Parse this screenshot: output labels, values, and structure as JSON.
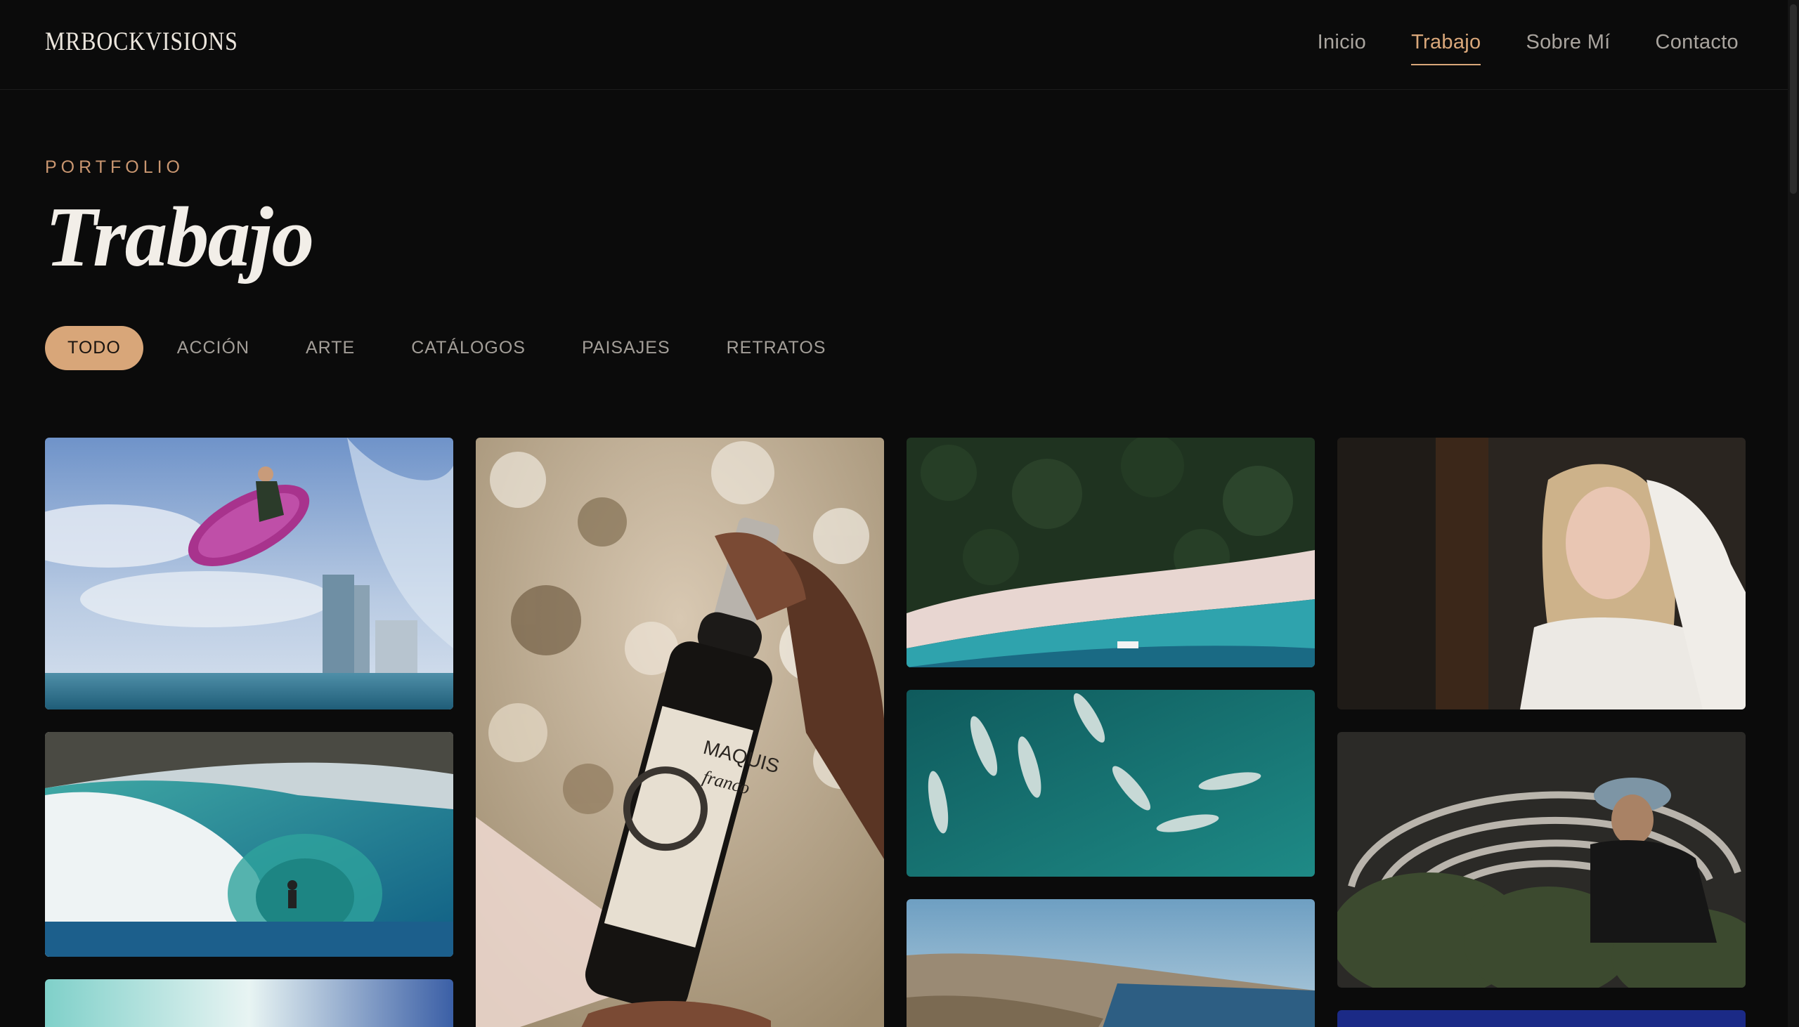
{
  "brand": {
    "logo": "MRBOCKVISIONS"
  },
  "nav": {
    "items": [
      {
        "label": "Inicio"
      },
      {
        "label": "Trabajo",
        "active": true
      },
      {
        "label": "Sobre Mí"
      },
      {
        "label": "Contacto"
      }
    ]
  },
  "hero": {
    "eyebrow": "PORTFOLIO",
    "title": "Trabajo"
  },
  "filters": {
    "items": [
      {
        "label": "TODO",
        "active": true
      },
      {
        "label": "ACCIÓN"
      },
      {
        "label": "ARTE"
      },
      {
        "label": "CATÁLOGOS"
      },
      {
        "label": "PAISAJES"
      },
      {
        "label": "RETRATOS"
      }
    ]
  },
  "gallery": {
    "photos": [
      {
        "subject": "surfer-aerial-jump"
      },
      {
        "subject": "surfer-in-barrel-wave"
      },
      {
        "subject": "ocean-wave"
      },
      {
        "subject": "wine-bottle",
        "label_text": [
          "MAQUIS",
          "franco"
        ]
      },
      {
        "subject": "aerial-beach"
      },
      {
        "subject": "dolphins"
      },
      {
        "subject": "coastal-landscape"
      },
      {
        "subject": "woman-portrait"
      },
      {
        "subject": "man-with-plants"
      },
      {
        "subject": "blue-frame"
      }
    ]
  },
  "colors": {
    "background": "#0b0b0b",
    "accent": "#d8a679",
    "text_muted": "#a9a49e"
  }
}
